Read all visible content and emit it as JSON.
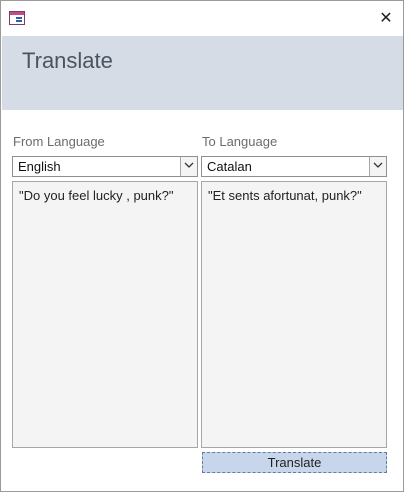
{
  "window": {
    "icon": "form-icon",
    "close_glyph": "✕"
  },
  "header": {
    "title": "Translate"
  },
  "from": {
    "label": "From Language",
    "selected": "English",
    "text": "\"Do you feel lucky , punk?\""
  },
  "to": {
    "label": "To Language",
    "selected": "Catalan",
    "text": "\"Et sents afortunat, punk?\""
  },
  "actions": {
    "translate_label": "Translate"
  },
  "colors": {
    "header_bg": "#d5dce6",
    "button_bg": "#c8d6ec"
  }
}
